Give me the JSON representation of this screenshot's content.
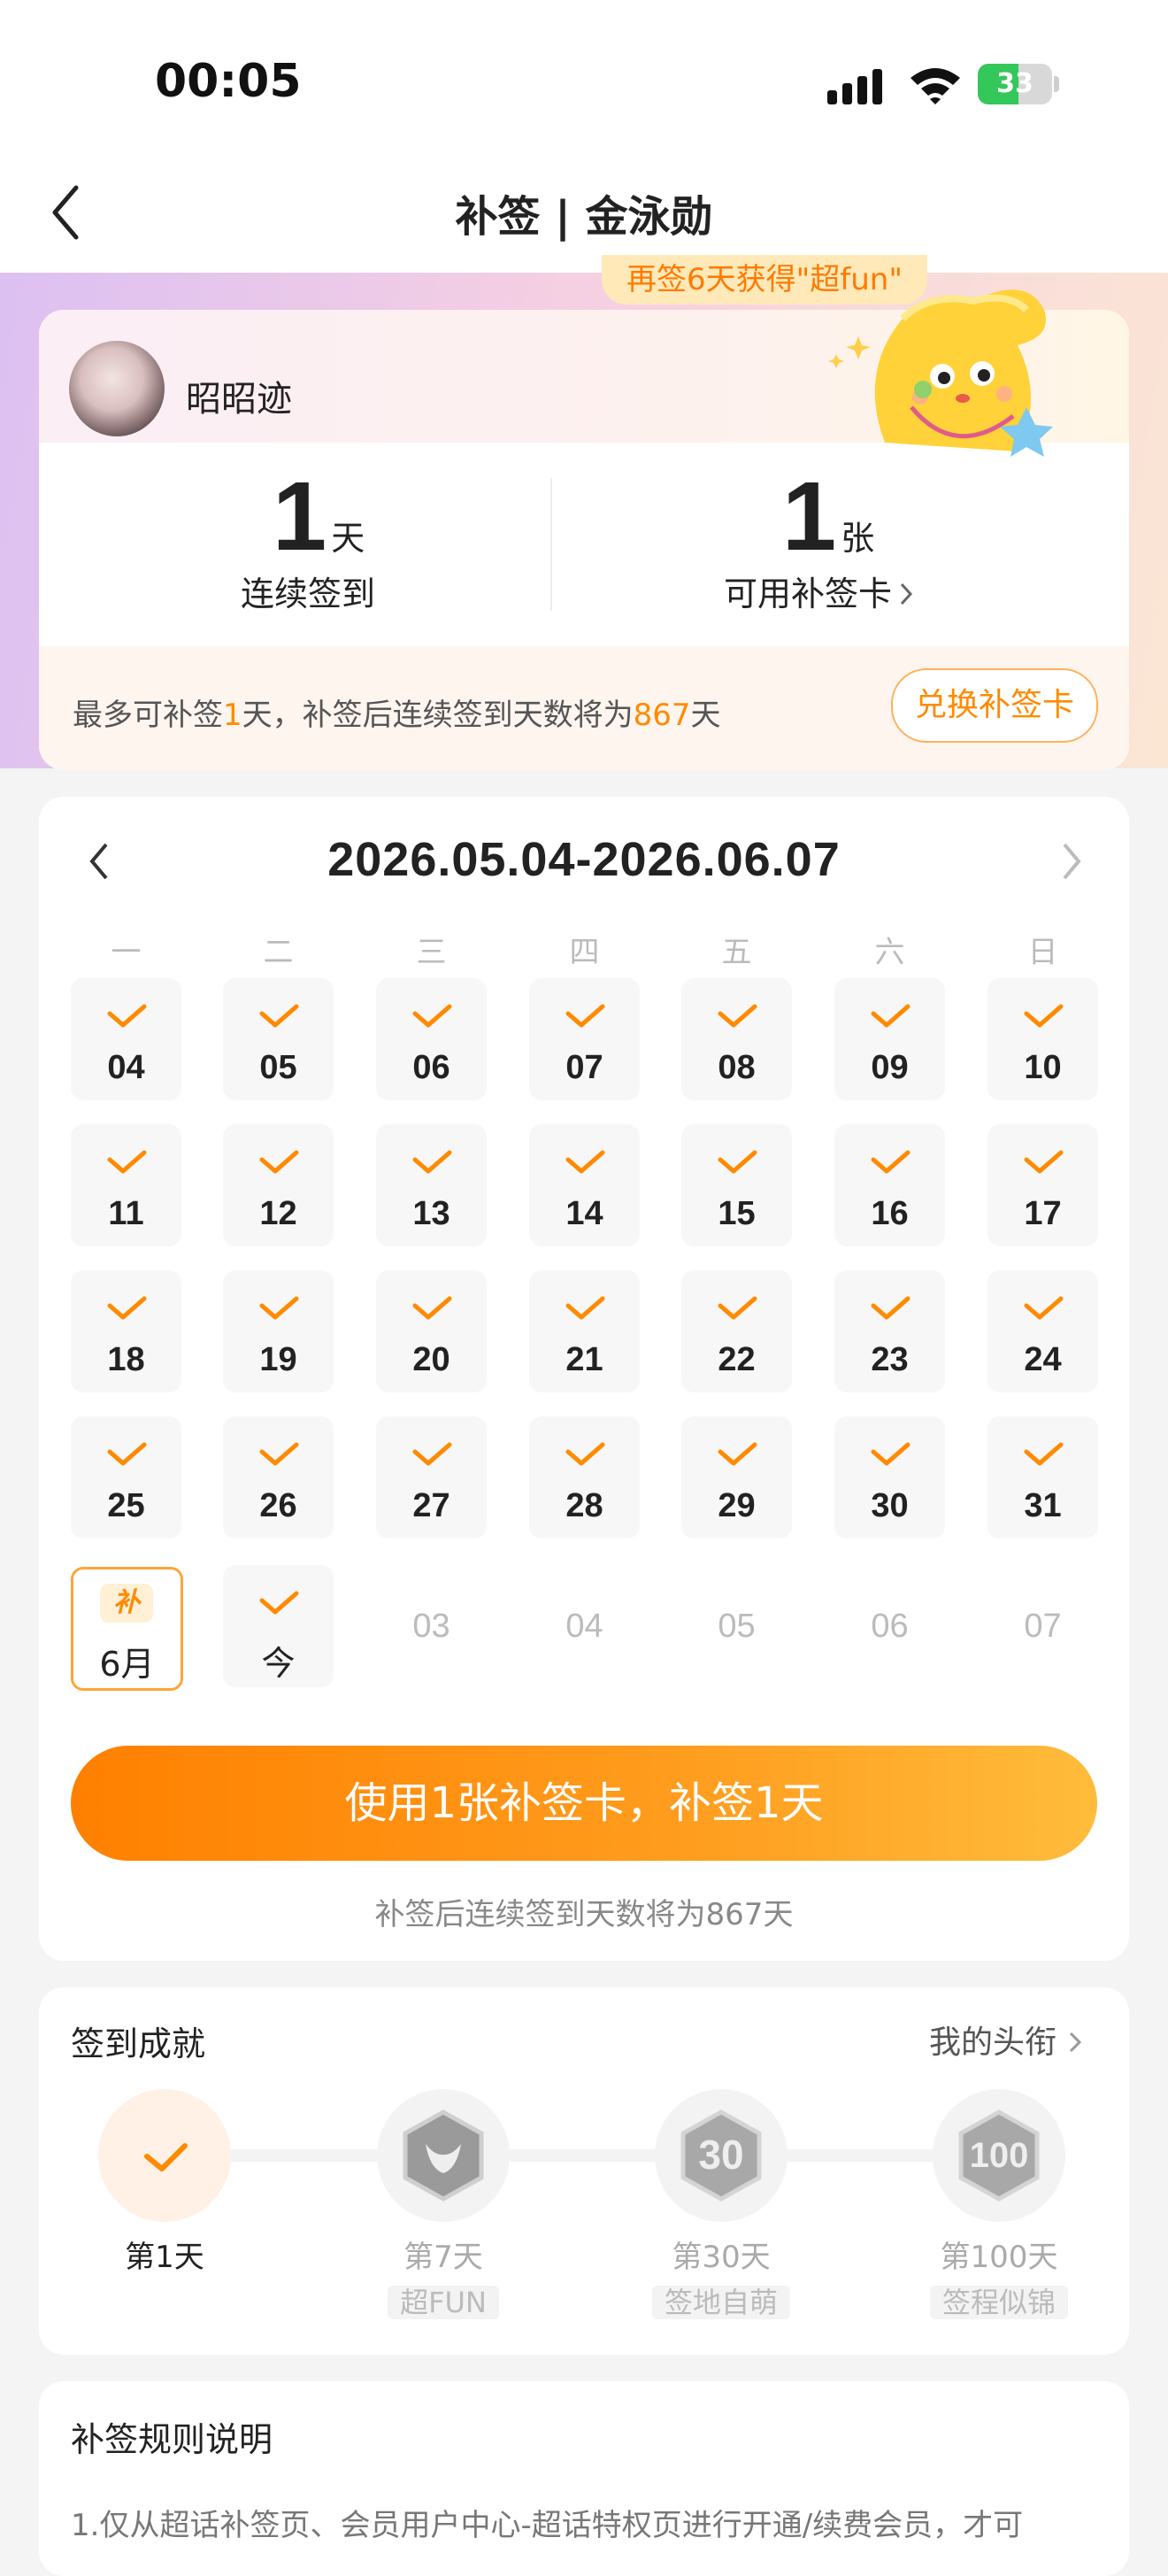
{
  "status": {
    "time": "00:05",
    "battery": "33"
  },
  "nav": {
    "title": "补签 | 金泳勋"
  },
  "profile": {
    "banner": "再签6天获得\"超fun\"",
    "username": "昭昭迹",
    "streak": {
      "value": "1",
      "unit": "天",
      "label": "连续签到"
    },
    "cards": {
      "value": "1",
      "unit": "张",
      "label": "可用补签卡"
    },
    "tip": {
      "prefix": "最多可补签",
      "days": "1",
      "mid": "天，补签后连续签到天数将为",
      "total": "867",
      "suffix": "天"
    },
    "exchange_label": "兑换补签卡"
  },
  "calendar": {
    "range": "2026.05.04-2026.06.07",
    "weekdays": [
      "一",
      "二",
      "三",
      "四",
      "五",
      "六",
      "日"
    ],
    "weeks": [
      [
        "04",
        "05",
        "06",
        "07",
        "08",
        "09",
        "10"
      ],
      [
        "11",
        "12",
        "13",
        "14",
        "15",
        "16",
        "17"
      ],
      [
        "18",
        "19",
        "20",
        "21",
        "22",
        "23",
        "24"
      ],
      [
        "25",
        "26",
        "27",
        "28",
        "29",
        "30",
        "31"
      ]
    ],
    "last_row": {
      "makeup_badge": "补",
      "makeup_label": "6月",
      "today_label": "今",
      "future": [
        "03",
        "04",
        "05",
        "06",
        "07"
      ]
    },
    "use_button": "使用1张补签卡，补签1天",
    "hint": "补签后连续签到天数将为867天"
  },
  "achievements": {
    "title": "签到成就",
    "link": "我的头衔",
    "items": [
      {
        "label": "第1天",
        "tag": ""
      },
      {
        "label": "第7天",
        "tag": "超FUN"
      },
      {
        "label": "第30天",
        "tag": "签地自萌"
      },
      {
        "label": "第100天",
        "tag": "签程似锦"
      }
    ]
  },
  "rules": {
    "title": "补签规则说明",
    "text": "1.仅从超话补签页、会员用户中心-超话特权页进行开通/续费会员，才可"
  },
  "colors": {
    "accent": "#ff8a00",
    "button_start": "#ff8000",
    "button_end": "#ffbc3b"
  }
}
